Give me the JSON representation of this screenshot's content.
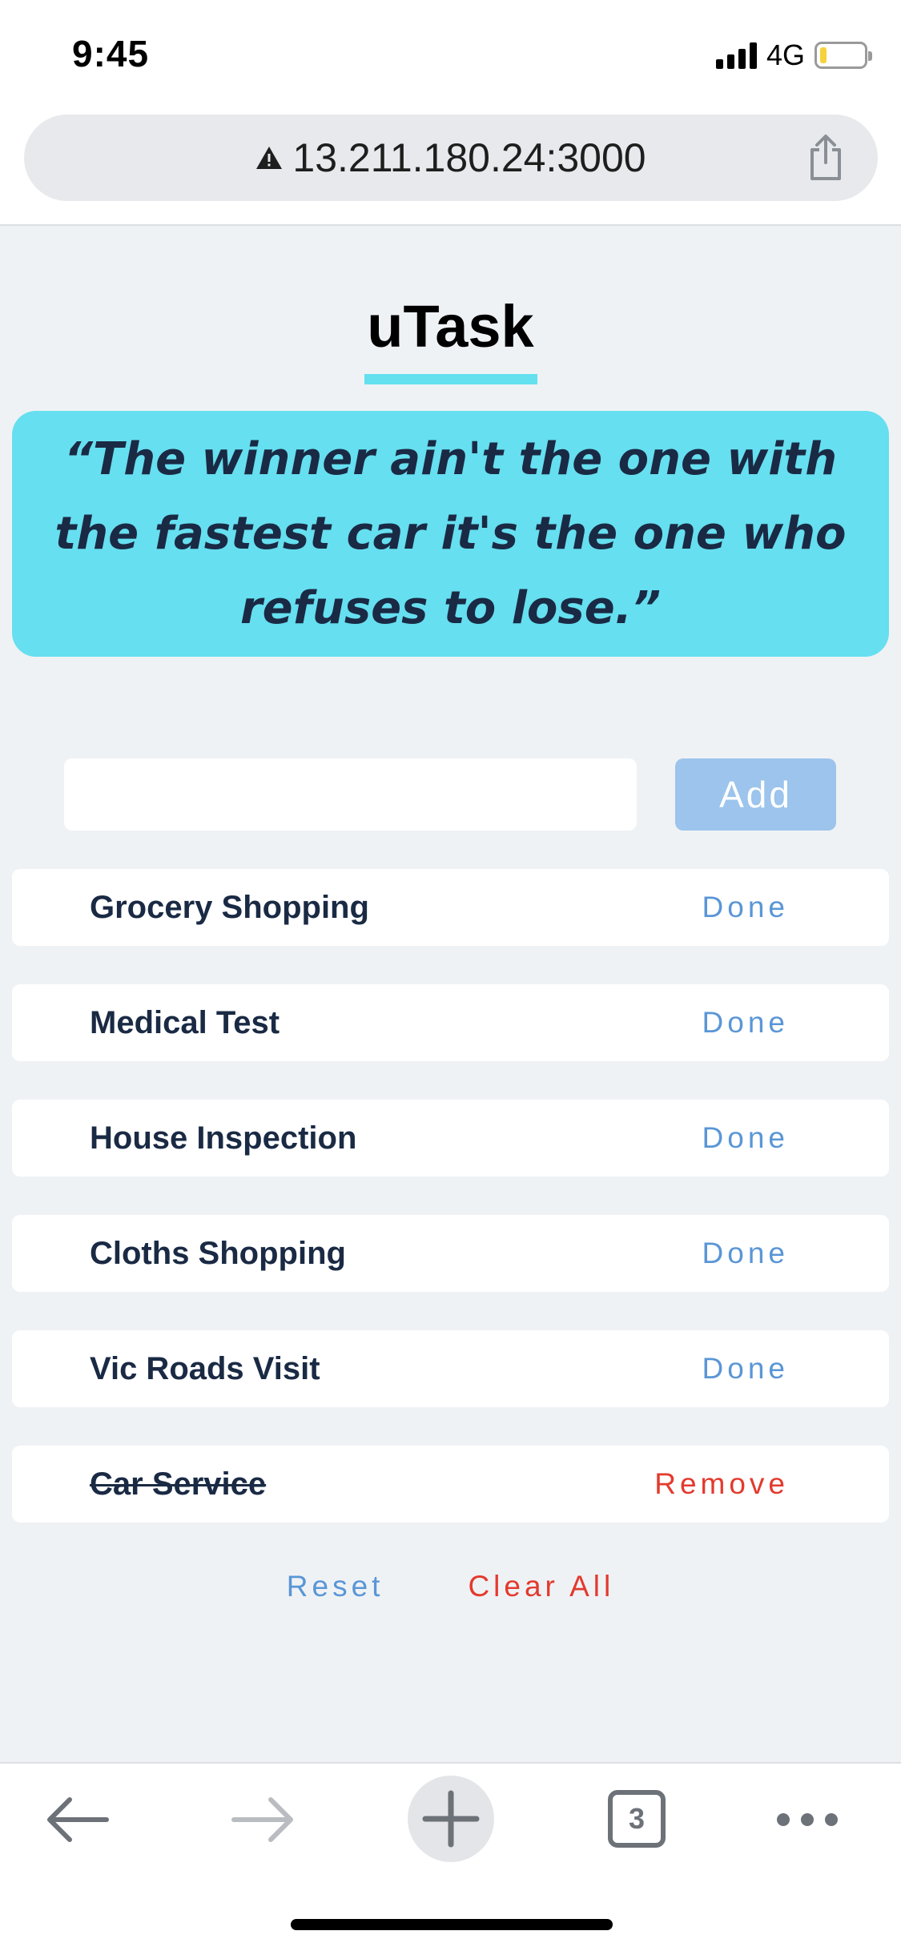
{
  "status_bar": {
    "time": "9:45",
    "network": "4G",
    "battery_level": 0.15
  },
  "browser": {
    "url": "13.211.180.24:3000",
    "tab_count": "3"
  },
  "app": {
    "title": "uTask",
    "quote": "“The winner ain't the one with the fastest car it's the one who refuses to lose.”",
    "input_value": "",
    "add_label": "Add",
    "tasks": [
      {
        "label": "Grocery Shopping",
        "action": "Done"
      },
      {
        "label": "Medical Test",
        "action": "Done"
      },
      {
        "label": "House Inspection",
        "action": "Done"
      },
      {
        "label": "Cloths Shopping",
        "action": "Done"
      },
      {
        "label": "Vic Roads Visit",
        "action": "Done"
      },
      {
        "label": "Car Service",
        "action": "Remove"
      }
    ],
    "reset_label": "Reset",
    "clear_all_label": "Clear All"
  },
  "colors": {
    "accent": "#66dff0",
    "link": "#5a96d6",
    "danger": "#e33a2e",
    "button": "#9cc4ec"
  }
}
